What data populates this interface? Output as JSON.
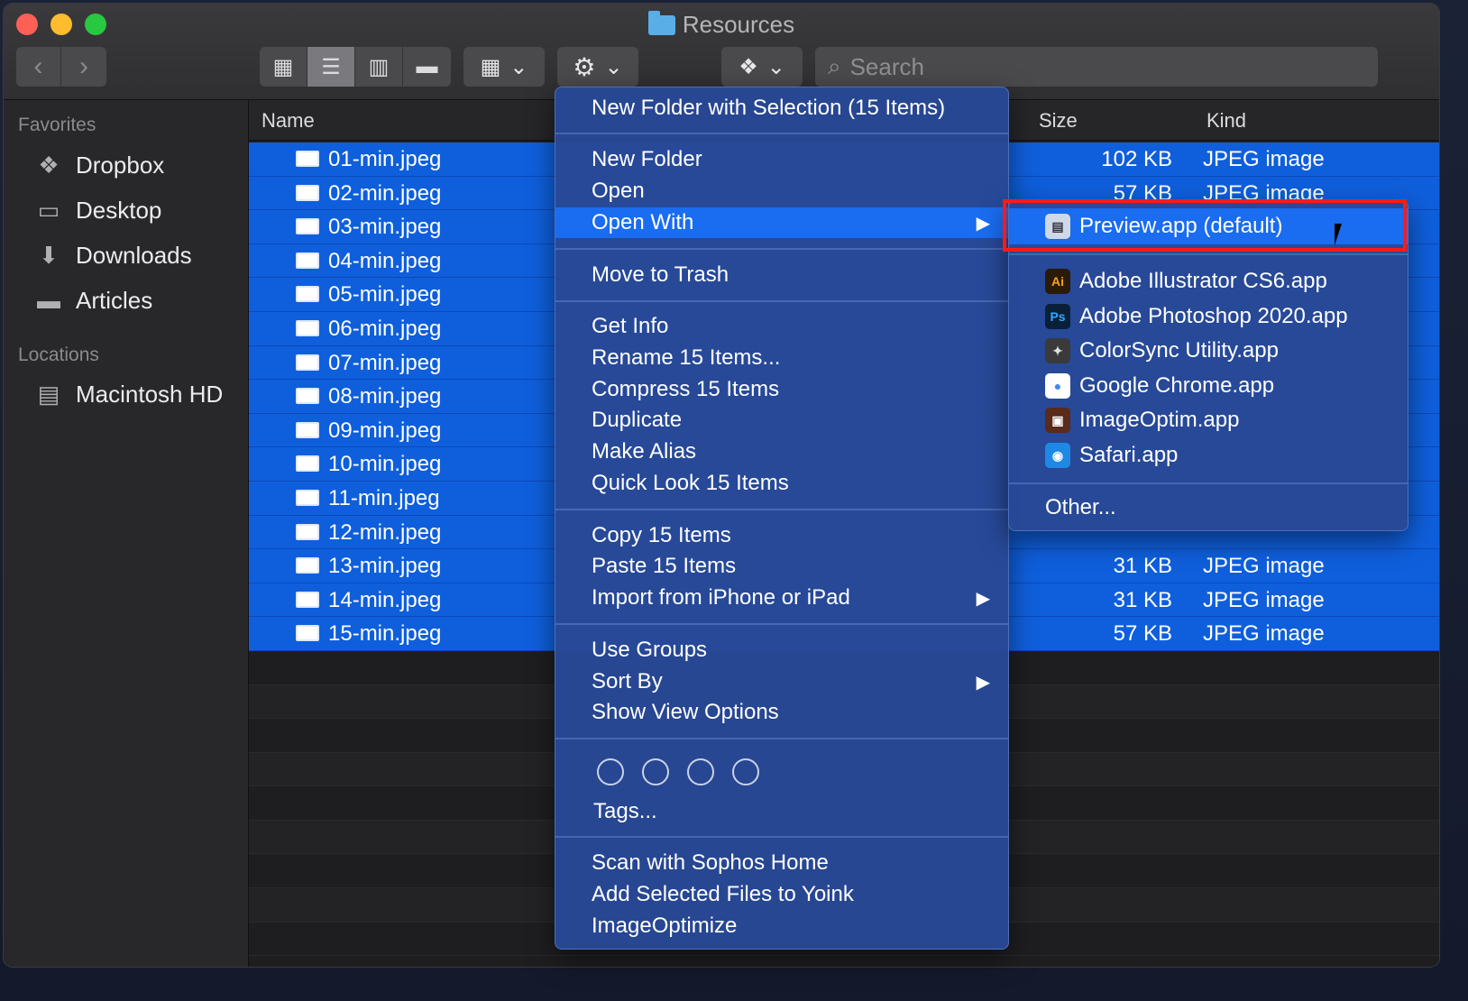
{
  "window": {
    "title": "Resources"
  },
  "toolbar": {
    "back_icon": "‹",
    "forward_icon": "›",
    "search_placeholder": "Search"
  },
  "sidebar": {
    "favorites_heading": "Favorites",
    "favorites": [
      {
        "label": "Dropbox",
        "icon": "dropbox-icon"
      },
      {
        "label": "Desktop",
        "icon": "desktop-icon"
      },
      {
        "label": "Downloads",
        "icon": "downloads-icon"
      },
      {
        "label": "Articles",
        "icon": "folder-icon"
      }
    ],
    "locations_heading": "Locations",
    "locations": [
      {
        "label": "Macintosh HD",
        "icon": "disk-icon"
      }
    ]
  },
  "columns": {
    "name": "Name",
    "size": "Size",
    "kind": "Kind"
  },
  "files": [
    {
      "name": "01-min.jpeg",
      "size": "102 KB",
      "kind": "JPEG image"
    },
    {
      "name": "02-min.jpeg",
      "size": "57 KB",
      "kind": "JPEG image"
    },
    {
      "name": "03-min.jpeg",
      "size": "",
      "kind": ""
    },
    {
      "name": "04-min.jpeg",
      "size": "",
      "kind": ""
    },
    {
      "name": "05-min.jpeg",
      "size": "",
      "kind": ""
    },
    {
      "name": "06-min.jpeg",
      "size": "",
      "kind": ""
    },
    {
      "name": "07-min.jpeg",
      "size": "",
      "kind": ""
    },
    {
      "name": "08-min.jpeg",
      "size": "",
      "kind": ""
    },
    {
      "name": "09-min.jpeg",
      "size": "",
      "kind": ""
    },
    {
      "name": "10-min.jpeg",
      "size": "",
      "kind": ""
    },
    {
      "name": "11-min.jpeg",
      "size": "",
      "kind": ""
    },
    {
      "name": "12-min.jpeg",
      "size": "",
      "kind": ""
    },
    {
      "name": "13-min.jpeg",
      "size": "31 KB",
      "kind": "JPEG image"
    },
    {
      "name": "14-min.jpeg",
      "size": "31 KB",
      "kind": "JPEG image"
    },
    {
      "name": "15-min.jpeg",
      "size": "57 KB",
      "kind": "JPEG image"
    }
  ],
  "context_menu": {
    "new_folder_with_selection": "New Folder with Selection (15 Items)",
    "new_folder": "New Folder",
    "open": "Open",
    "open_with": "Open With",
    "move_to_trash": "Move to Trash",
    "get_info": "Get Info",
    "rename": "Rename 15 Items...",
    "compress": "Compress 15 Items",
    "duplicate": "Duplicate",
    "make_alias": "Make Alias",
    "quick_look": "Quick Look 15 Items",
    "copy": "Copy 15 Items",
    "paste": "Paste 15 Items",
    "import": "Import from iPhone or iPad",
    "use_groups": "Use Groups",
    "sort_by": "Sort By",
    "show_view_options": "Show View Options",
    "tags": "Tags...",
    "scan": "Scan with Sophos Home",
    "yoink": "Add Selected Files to Yoink",
    "imageoptimize": "ImageOptimize",
    "submenu_arrow": "▶"
  },
  "open_with_menu": {
    "default_app": "Preview.app (default)",
    "apps": [
      {
        "label": "Adobe Illustrator CS6.app",
        "icon": "illustrator-icon",
        "badge": "Ai",
        "color": "#2a1a08",
        "fg": "#f7a21b"
      },
      {
        "label": "Adobe Photoshop 2020.app",
        "icon": "photoshop-icon",
        "badge": "Ps",
        "color": "#0a1f38",
        "fg": "#31a8ff"
      },
      {
        "label": "ColorSync Utility.app",
        "icon": "colorsync-icon",
        "badge": "✦",
        "color": "#3a3a3a",
        "fg": "#e0e0e0"
      },
      {
        "label": "Google Chrome.app",
        "icon": "chrome-icon",
        "badge": "●",
        "color": "#ffffff",
        "fg": "#4285f4"
      },
      {
        "label": "ImageOptim.app",
        "icon": "imageoptim-icon",
        "badge": "▣",
        "color": "#5a2a1a",
        "fg": "#ffffff"
      },
      {
        "label": "Safari.app",
        "icon": "safari-icon",
        "badge": "◉",
        "color": "#1e88e5",
        "fg": "#ffffff"
      }
    ],
    "other": "Other..."
  }
}
